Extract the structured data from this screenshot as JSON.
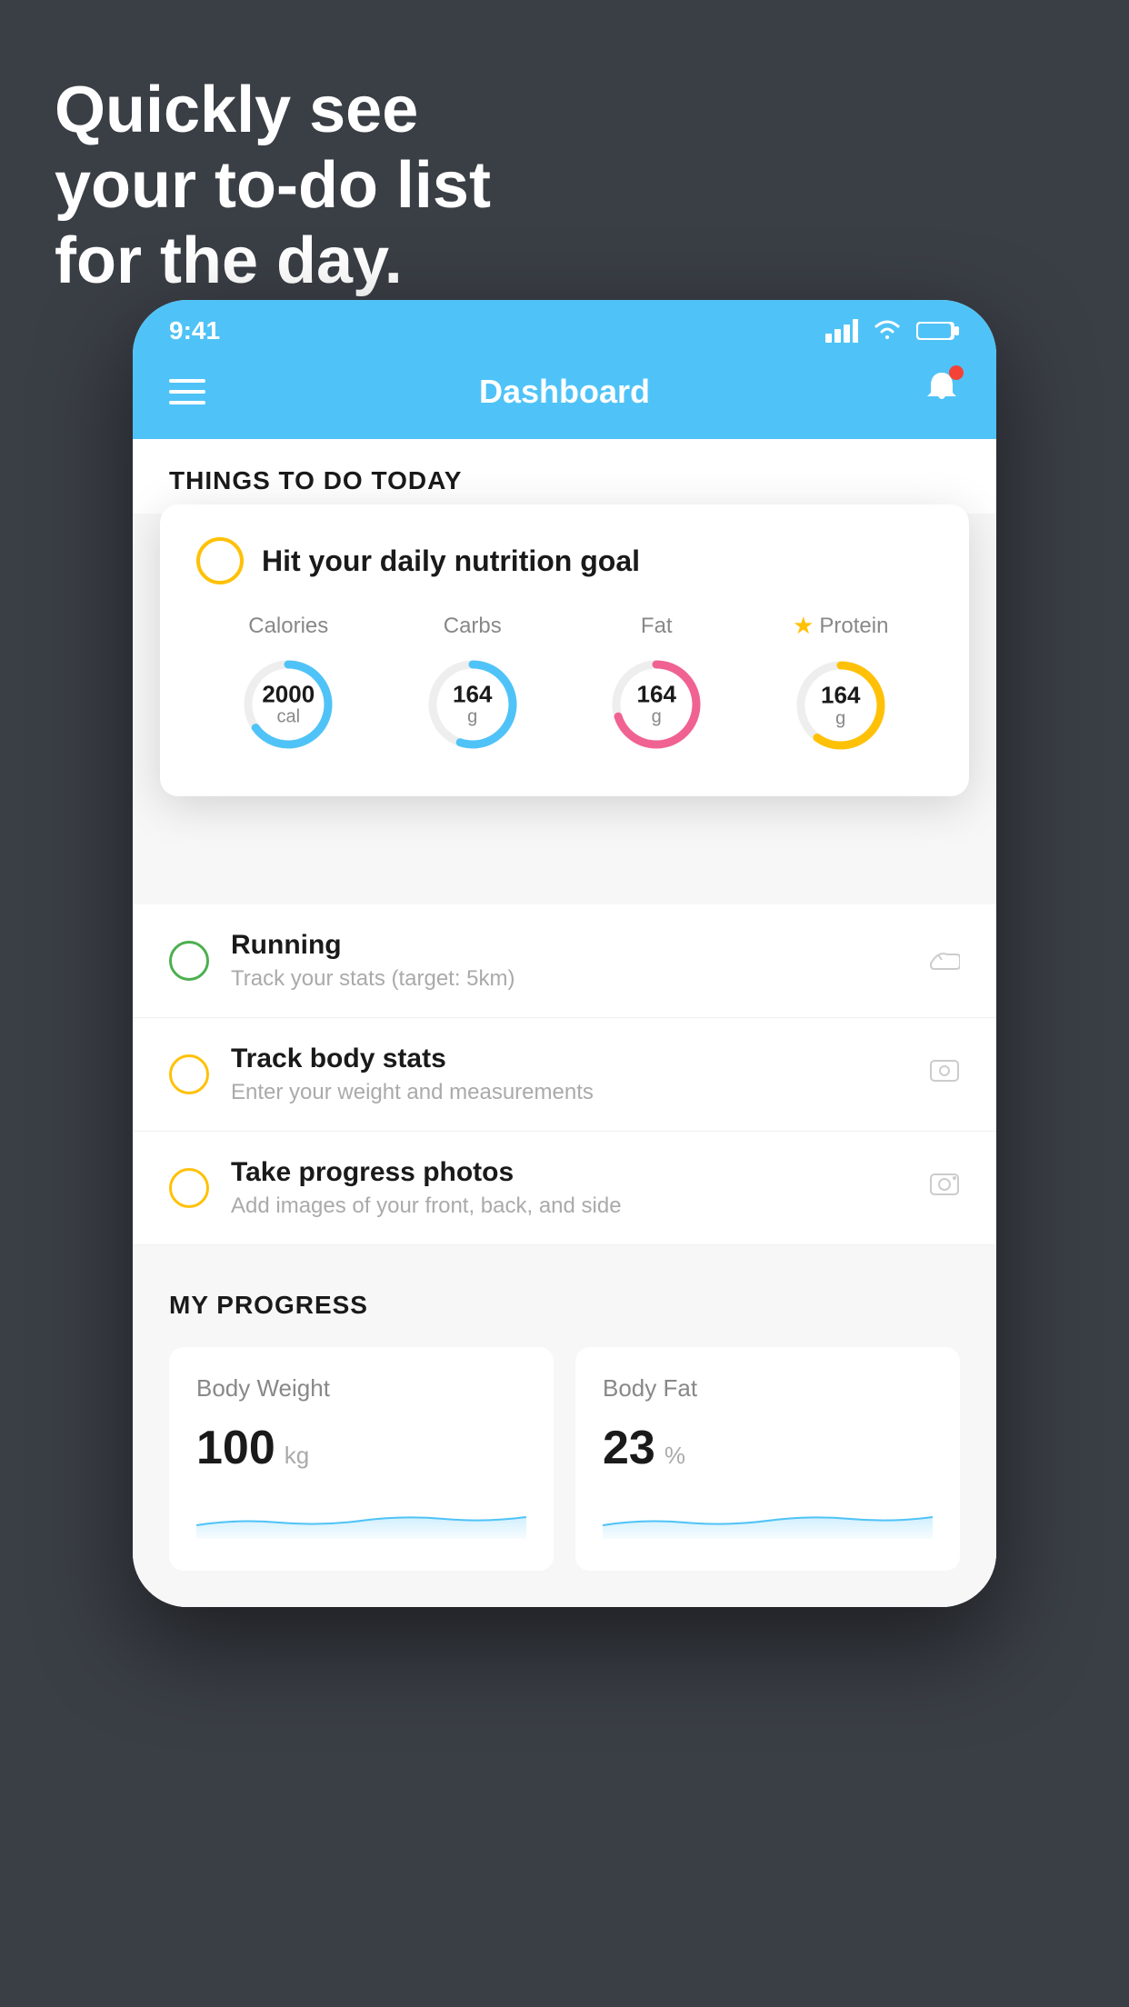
{
  "hero": {
    "line1": "Quickly see",
    "line2": "your to-do list",
    "line3": "for the day."
  },
  "statusBar": {
    "time": "9:41"
  },
  "header": {
    "title": "Dashboard"
  },
  "sectionTitle": "THINGS TO DO TODAY",
  "nutritionCard": {
    "checkColor": "#ffc107",
    "title": "Hit your daily nutrition goal",
    "items": [
      {
        "label": "Calories",
        "value": "2000",
        "unit": "cal",
        "color": "#4fc3f7",
        "pct": 65,
        "starred": false
      },
      {
        "label": "Carbs",
        "value": "164",
        "unit": "g",
        "color": "#4fc3f7",
        "pct": 55,
        "starred": false
      },
      {
        "label": "Fat",
        "value": "164",
        "unit": "g",
        "color": "#f06292",
        "pct": 70,
        "starred": false
      },
      {
        "label": "Protein",
        "value": "164",
        "unit": "g",
        "color": "#ffc107",
        "pct": 60,
        "starred": true
      }
    ]
  },
  "todoItems": [
    {
      "id": "running",
      "title": "Running",
      "subtitle": "Track your stats (target: 5km)",
      "circleColor": "green",
      "iconName": "shoe-icon"
    },
    {
      "id": "body-stats",
      "title": "Track body stats",
      "subtitle": "Enter your weight and measurements",
      "circleColor": "yellow",
      "iconName": "scale-icon"
    },
    {
      "id": "progress-photos",
      "title": "Take progress photos",
      "subtitle": "Add images of your front, back, and side",
      "circleColor": "yellow",
      "iconName": "photo-icon"
    }
  ],
  "progress": {
    "sectionTitle": "MY PROGRESS",
    "cards": [
      {
        "title": "Body Weight",
        "value": "100",
        "unit": "kg"
      },
      {
        "title": "Body Fat",
        "value": "23",
        "unit": "%"
      }
    ]
  }
}
